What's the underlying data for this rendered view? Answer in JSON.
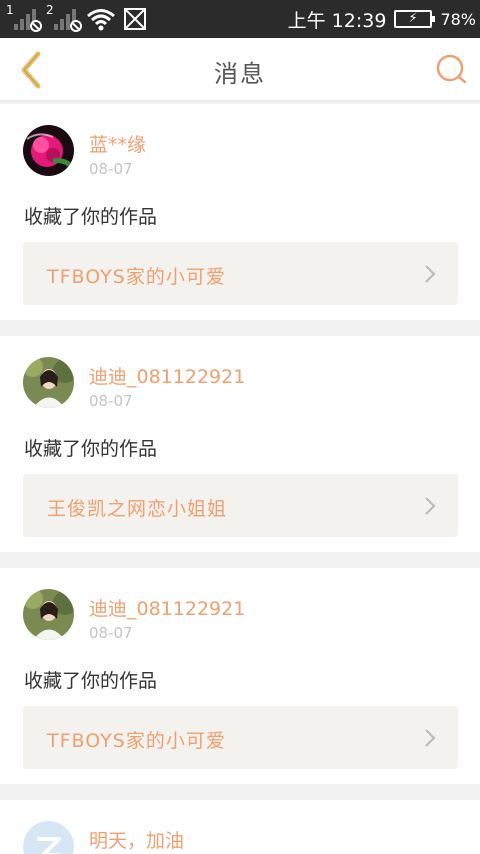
{
  "status_bar": {
    "sim1": "1",
    "sim2": "2",
    "time": "上午 12:39",
    "battery_pct": "78%",
    "icons": [
      "signal-icon",
      "signal-icon",
      "wifi-icon",
      "no-sim-icon",
      "battery-charging-icon"
    ]
  },
  "header": {
    "title": "消息",
    "back_icon": "chevron-left-icon",
    "search_icon": "search-icon",
    "accent": "#e8c06a"
  },
  "messages": [
    {
      "user": "蓝**缘",
      "date": "08-07",
      "action": "收藏了你的作品",
      "work": "TFBOYS家的小可爱",
      "avatar": "flower"
    },
    {
      "user": "迪迪_081122921",
      "date": "08-07",
      "action": "收藏了你的作品",
      "work": "王俊凯之网恋小姐姐",
      "avatar": "person"
    },
    {
      "user": "迪迪_081122921",
      "date": "08-07",
      "action": "收藏了你的作品",
      "work": "TFBOYS家的小可爱",
      "avatar": "person"
    },
    {
      "user": "明天，加油",
      "avatar": "default"
    }
  ],
  "colors": {
    "username": "#f0a070",
    "date": "#c4c4c4",
    "work_bg": "#f3f2ee"
  }
}
